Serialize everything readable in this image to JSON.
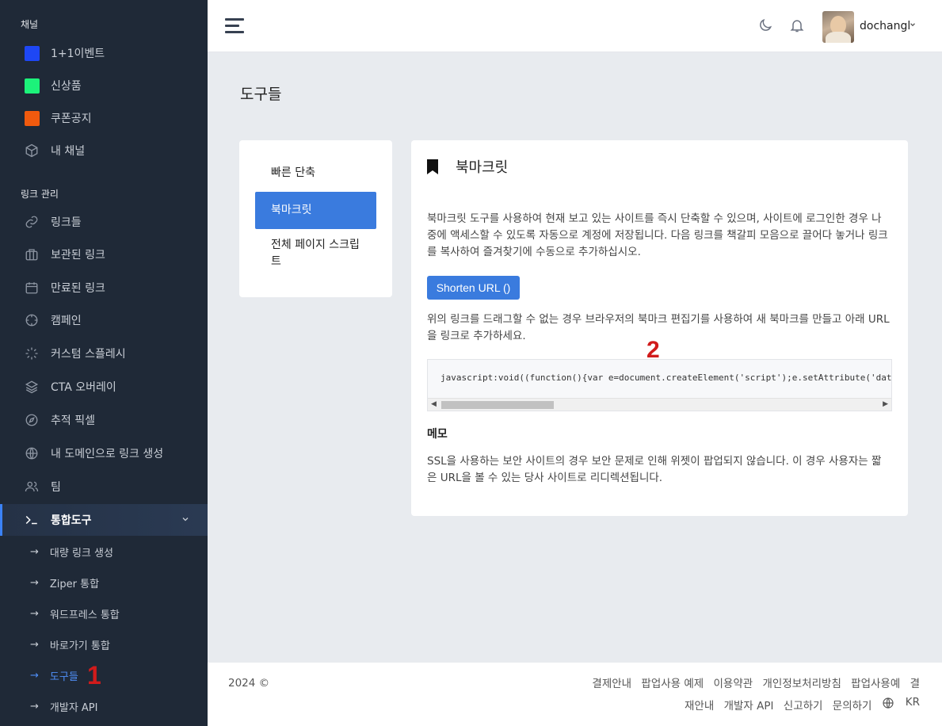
{
  "sidebar": {
    "channel_title": "채널",
    "channels": [
      {
        "label": "1+1이벤트",
        "color": "#1e47f5"
      },
      {
        "label": "신상품",
        "color": "#1cf27a"
      },
      {
        "label": "쿠폰공지",
        "color": "#f05a0e"
      },
      {
        "label": "내 채널",
        "icon": "box-icon"
      }
    ],
    "links_title": "링크 관리",
    "links": [
      {
        "label": "링크들",
        "icon": "link-icon"
      },
      {
        "label": "보관된 링크",
        "icon": "archive-icon"
      },
      {
        "label": "만료된 링크",
        "icon": "calendar-icon"
      },
      {
        "label": "캠페인",
        "icon": "crosshair-icon"
      },
      {
        "label": "커스텀 스플레시",
        "icon": "loader-icon"
      },
      {
        "label": "CTA 오버레이",
        "icon": "layers-icon"
      },
      {
        "label": "추적 픽셀",
        "icon": "compass-icon"
      },
      {
        "label": "내 도메인으로 링크 생성",
        "icon": "globe-icon"
      },
      {
        "label": "팀",
        "icon": "users-icon"
      },
      {
        "label": "통합도구",
        "icon": "terminal-icon",
        "active": true
      }
    ],
    "integrations": [
      "대량 링크 생성",
      "Ziper 통합",
      "워드프레스 통합",
      "바로가기 통합",
      "도구들",
      "개발자 API"
    ],
    "marker": "1"
  },
  "topbar": {
    "username": "dochangl"
  },
  "page": {
    "title": "도구들",
    "tabs": [
      "빠른 단축",
      "북마크릿",
      "전체 페이지 스크립트"
    ],
    "card_title": "북마크릿",
    "description": "북마크릿 도구를 사용하여 현재 보고 있는 사이트를 즉시 단축할 수 있으며, 사이트에 로그인한 경우 나중에 액세스할 수 있도록 자동으로 계정에 저장됩니다. 다음 링크를 책갈피 모음으로 끌어다 놓거나 링크를 복사하여 즐겨찾기에 수동으로 추가하십시오.",
    "button_label": "Shorten URL ()",
    "drag_help": "위의 링크를 드래그할 수 없는 경우 브라우저의 북마크 편집기를 사용하여 새 북마크를 만들고 아래 URL을 링크로 추가하세요.",
    "marker": "2",
    "code": "javascript:void((function(){var e=document.createElement('script');e.setAttribute('data-url','",
    "memo_title": "메모",
    "memo_text": "SSL을 사용하는 보안 사이트의 경우 보안 문제로 인해 위젯이 팝업되지 않습니다. 이 경우 사용자는 짧은 URL을 볼 수 있는 당사 사이트로 리디렉션됩니다."
  },
  "footer": {
    "copyright": "2024 ©",
    "links": [
      "결제안내",
      "팝업사용 예제",
      "이용약관",
      "개인정보처리방침",
      "팝업사용예",
      "결재안내",
      "개발자 API",
      "신고하기",
      "문의하기"
    ],
    "lang": "KR"
  }
}
